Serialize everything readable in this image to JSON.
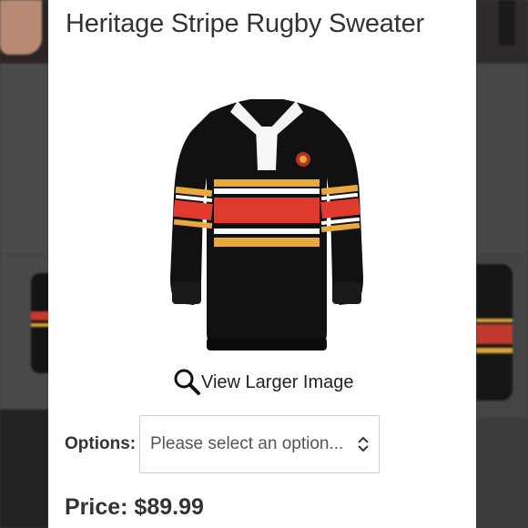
{
  "product": {
    "title": "Heritage Stripe Rugby Sweater",
    "image_alt": "Black rugby sweater with red, gold and white chest stripes",
    "view_larger_label": "View Larger Image",
    "options_label": "Options:",
    "options_placeholder": "Please select an option...",
    "price_text": "Price: $89.99"
  },
  "icons": {
    "zoom": "magnifier-icon",
    "select": "chevron-up-down-icon"
  },
  "colors": {
    "sweater_body": "#111111",
    "stripe_red": "#e03a2e",
    "stripe_gold": "#e7a93a",
    "stripe_white": "#ffffff",
    "text_primary": "#333333"
  }
}
